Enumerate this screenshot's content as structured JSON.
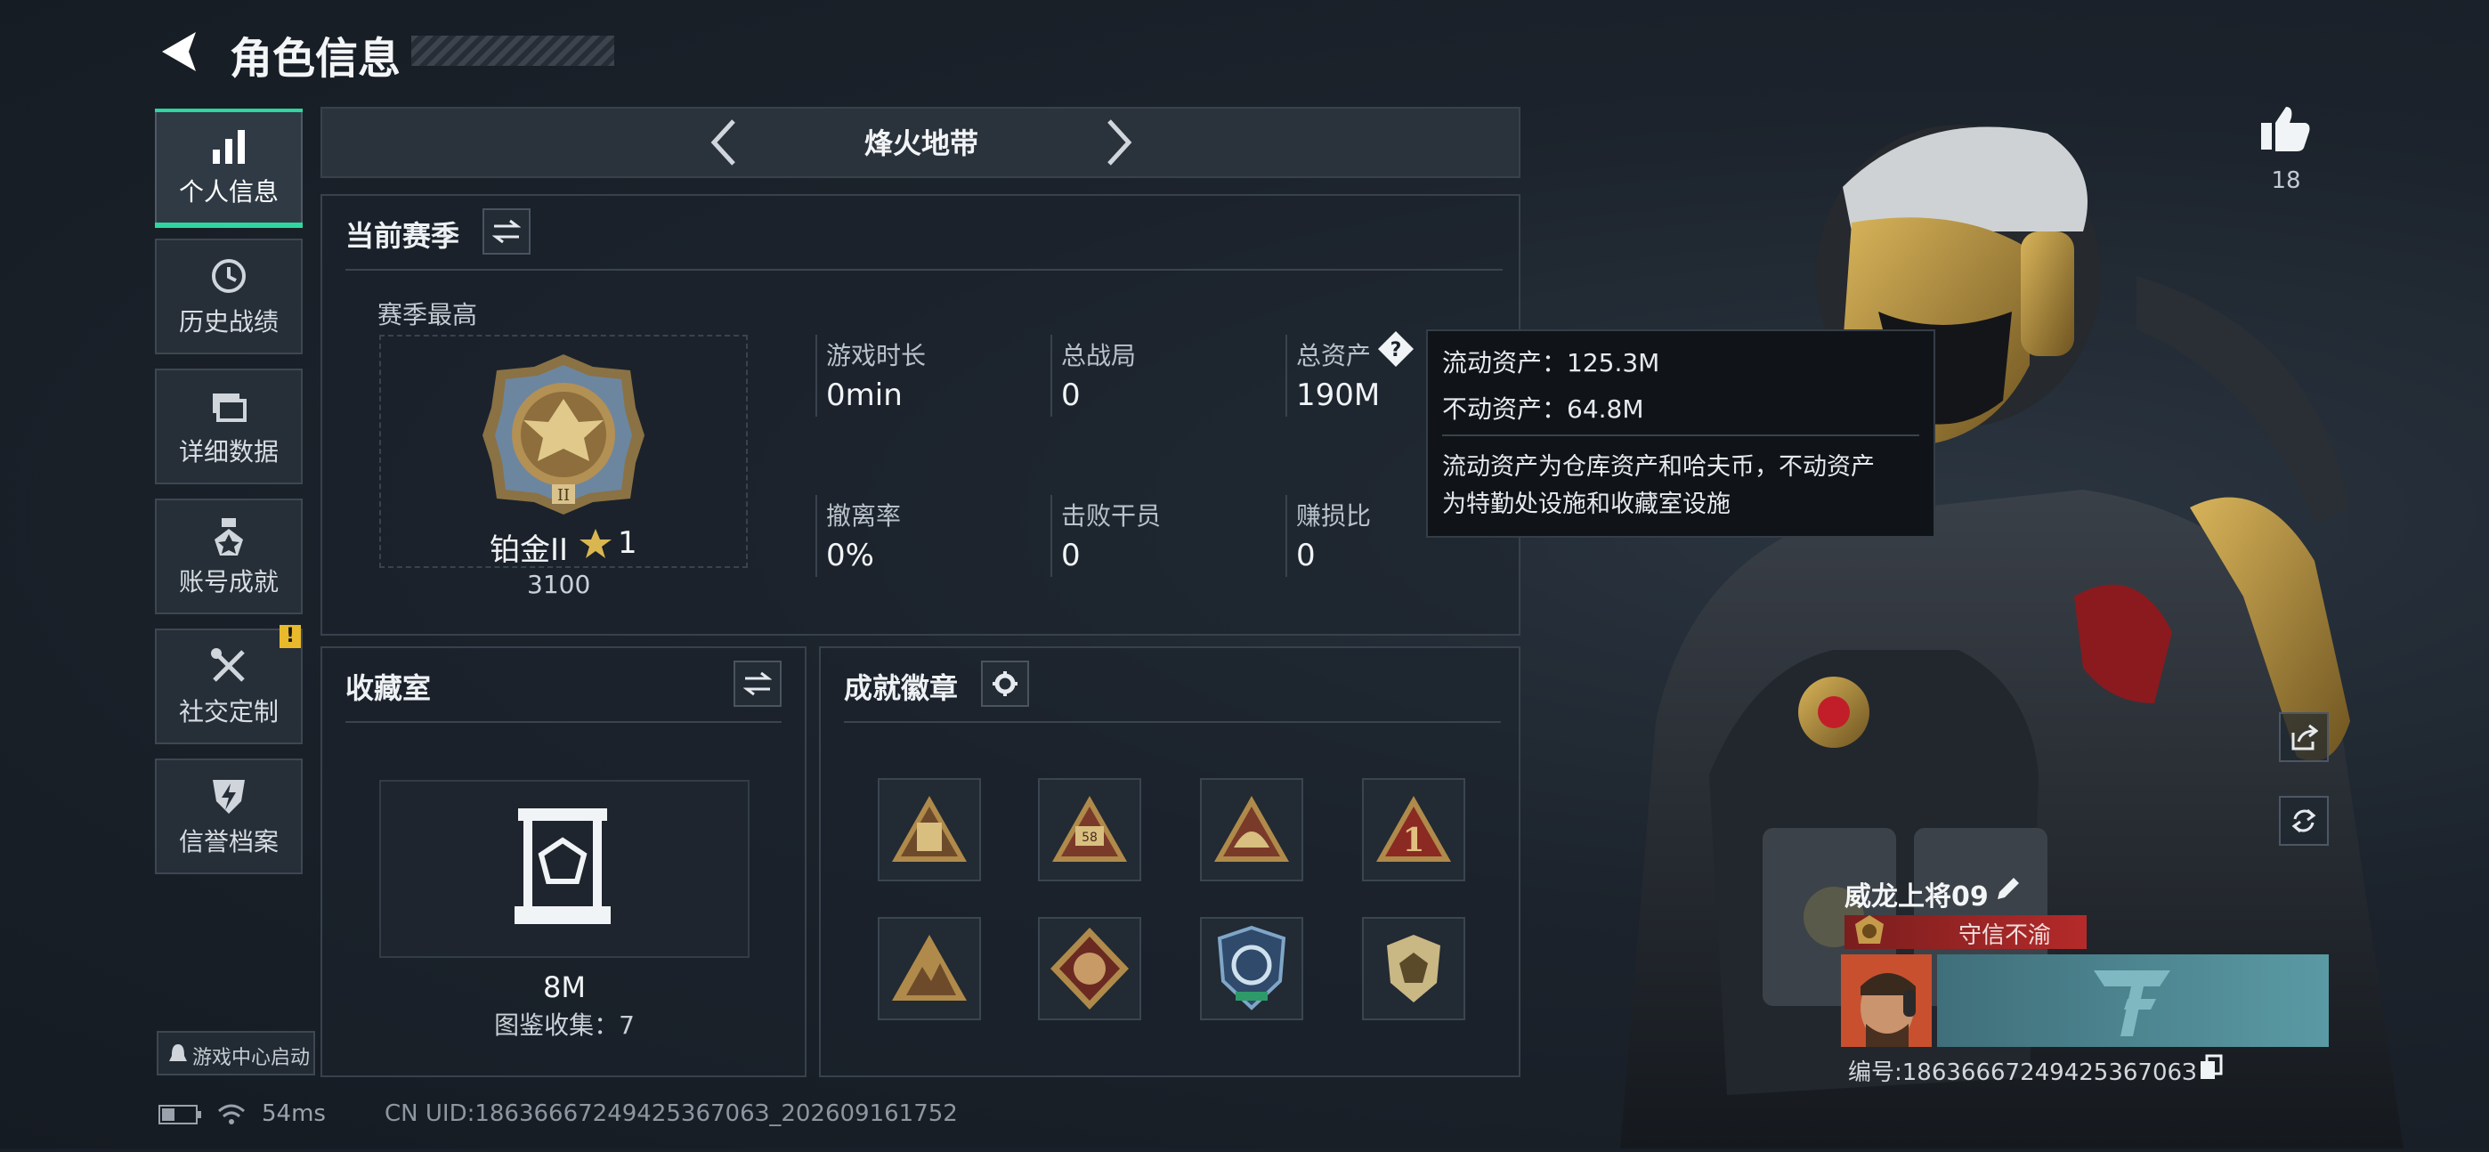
{
  "header": {
    "title": "角色信息"
  },
  "mode_selector": {
    "current": "烽火地带"
  },
  "nav": [
    {
      "label": "个人信息",
      "icon": "bar-chart-icon"
    },
    {
      "label": "历史战绩",
      "icon": "history-clock-icon"
    },
    {
      "label": "详细数据",
      "icon": "folder-stack-icon"
    },
    {
      "label": "账号成就",
      "icon": "medal-icon"
    },
    {
      "label": "社交定制",
      "icon": "tools-icon"
    },
    {
      "label": "信誉档案",
      "icon": "shield-bolt-icon"
    }
  ],
  "nav_alert": "!",
  "game_center": {
    "label": "游戏中心启动"
  },
  "season": {
    "title": "当前赛季",
    "best_label": "赛季最高",
    "rank_name": "铂金II",
    "rank_stars": "1",
    "rank_score": "3100",
    "stats": [
      {
        "label": "游戏时长",
        "value": "0min"
      },
      {
        "label": "总战局",
        "value": "0"
      },
      {
        "label": "总资产",
        "value": "190M"
      },
      {
        "label": "撤离率",
        "value": "0%"
      },
      {
        "label": "击败干员",
        "value": "0"
      },
      {
        "label": "赚损比",
        "value": "0"
      }
    ]
  },
  "tooltip": {
    "liquid": "流动资产：125.3M",
    "fixed": "不动资产：64.8M",
    "desc_line1": "流动资产为仓库资产和哈夫币，不动资产",
    "desc_line2": "为特勤处设施和收藏室设施"
  },
  "collection": {
    "title": "收藏室",
    "value": "8M",
    "count_text": "图鉴收集：7"
  },
  "badges": {
    "title": "成就徽章",
    "items": [
      "hourglass-badge-icon",
      "number-58-badge-icon",
      "helmet-badge-icon",
      "number-1-badge-icon",
      "mountain-badge-icon",
      "dragon-badge-icon",
      "shield-wing-badge-icon",
      "gem-shield-badge-icon"
    ]
  },
  "status_bar": {
    "ping": "54ms",
    "uid": "CN UID:1863666724942536706З_202609161752"
  },
  "profile": {
    "likes": "18",
    "name": "威龙上将09",
    "title_badge": "守信不渝",
    "id_text": "编号:1863666724942536706З"
  },
  "colors": {
    "accent": "#2fd6a0",
    "background": "#1a2029",
    "title_badge_red": "#b52a2a",
    "banner_teal": "#4f8a96"
  }
}
